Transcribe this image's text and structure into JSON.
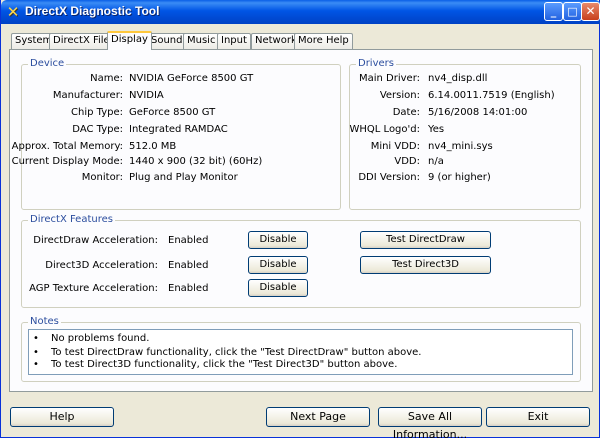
{
  "window": {
    "title": "DirectX Diagnostic Tool",
    "title_icon": "directx-x-icon",
    "minimize_glyph": "_",
    "maximize_glyph": "□",
    "close_glyph": "✕"
  },
  "tabs": [
    {
      "label": "System"
    },
    {
      "label": "DirectX Files"
    },
    {
      "label": "Display"
    },
    {
      "label": "Sound"
    },
    {
      "label": "Music"
    },
    {
      "label": "Input"
    },
    {
      "label": "Network"
    },
    {
      "label": "More Help"
    }
  ],
  "active_tab": "Display",
  "device": {
    "title": "Device",
    "rows": [
      {
        "label": "Name:",
        "value": "NVIDIA GeForce 8500 GT"
      },
      {
        "label": "Manufacturer:",
        "value": "NVIDIA"
      },
      {
        "label": "Chip Type:",
        "value": "GeForce 8500 GT"
      },
      {
        "label": "DAC Type:",
        "value": "Integrated RAMDAC"
      },
      {
        "label": "Approx. Total Memory:",
        "value": "512.0 MB"
      },
      {
        "label": "Current Display Mode:",
        "value": "1440 x 900 (32 bit) (60Hz)"
      },
      {
        "label": "Monitor:",
        "value": "Plug and Play Monitor"
      }
    ]
  },
  "drivers": {
    "title": "Drivers",
    "rows": [
      {
        "label": "Main Driver:",
        "value": "nv4_disp.dll"
      },
      {
        "label": "Version:",
        "value": "6.14.0011.7519 (English)"
      },
      {
        "label": "Date:",
        "value": "5/16/2008 14:01:00"
      },
      {
        "label": "WHQL Logo'd:",
        "value": "Yes"
      },
      {
        "label": "Mini VDD:",
        "value": "nv4_mini.sys"
      },
      {
        "label": "VDD:",
        "value": "n/a"
      },
      {
        "label": "DDI Version:",
        "value": "9 (or higher)"
      }
    ]
  },
  "features": {
    "title": "DirectX Features",
    "rows": [
      {
        "label": "DirectDraw Acceleration:",
        "value": "Enabled",
        "button": "Disable",
        "test_button": "Test DirectDraw"
      },
      {
        "label": "Direct3D Acceleration:",
        "value": "Enabled",
        "button": "Disable",
        "test_button": "Test Direct3D"
      },
      {
        "label": "AGP Texture Acceleration:",
        "value": "Enabled",
        "button": "Disable"
      }
    ]
  },
  "notes": {
    "title": "Notes",
    "bullet": "•",
    "items": [
      "No problems found.",
      "To test DirectDraw functionality, click the \"Test DirectDraw\" button above.",
      "To test Direct3D functionality, click the \"Test Direct3D\" button above."
    ]
  },
  "footer": {
    "help": "Help",
    "next_page": "Next Page",
    "save_all": "Save All Information...",
    "exit": "Exit"
  }
}
